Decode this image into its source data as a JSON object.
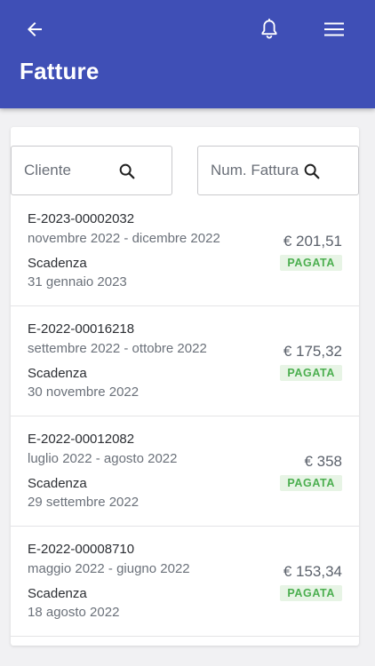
{
  "header": {
    "title": "Fatture",
    "back_icon": "arrow-left-icon",
    "notification_icon": "bell-icon",
    "menu_icon": "hamburger-menu-icon",
    "color": "#3f4fb6"
  },
  "filters": {
    "cliente_placeholder": "Cliente",
    "numero_placeholder": "Num. Fattura",
    "search_icon": "search-icon"
  },
  "status_colors": {
    "paid_text": "#4caf50",
    "paid_background": "#e7f4e5"
  },
  "invoices": [
    {
      "code": "E-2023-00002032",
      "period": "novembre 2022 - dicembre 2022",
      "due_label": "Scadenza",
      "due_date": "31 gennaio 2023",
      "amount": "€ 201,51",
      "status": "PAGATA"
    },
    {
      "code": "E-2022-00016218",
      "period": "settembre 2022 - ottobre 2022",
      "due_label": "Scadenza",
      "due_date": "30 novembre 2022",
      "amount": "€ 175,32",
      "status": "PAGATA"
    },
    {
      "code": "E-2022-00012082",
      "period": "luglio 2022 - agosto 2022",
      "due_label": "Scadenza",
      "due_date": "29 settembre 2022",
      "amount": "€ 358",
      "status": "PAGATA"
    },
    {
      "code": "E-2022-00008710",
      "period": "maggio 2022 - giugno 2022",
      "due_label": "Scadenza",
      "due_date": "18 agosto 2022",
      "amount": "€ 153,34",
      "status": "PAGATA"
    }
  ]
}
